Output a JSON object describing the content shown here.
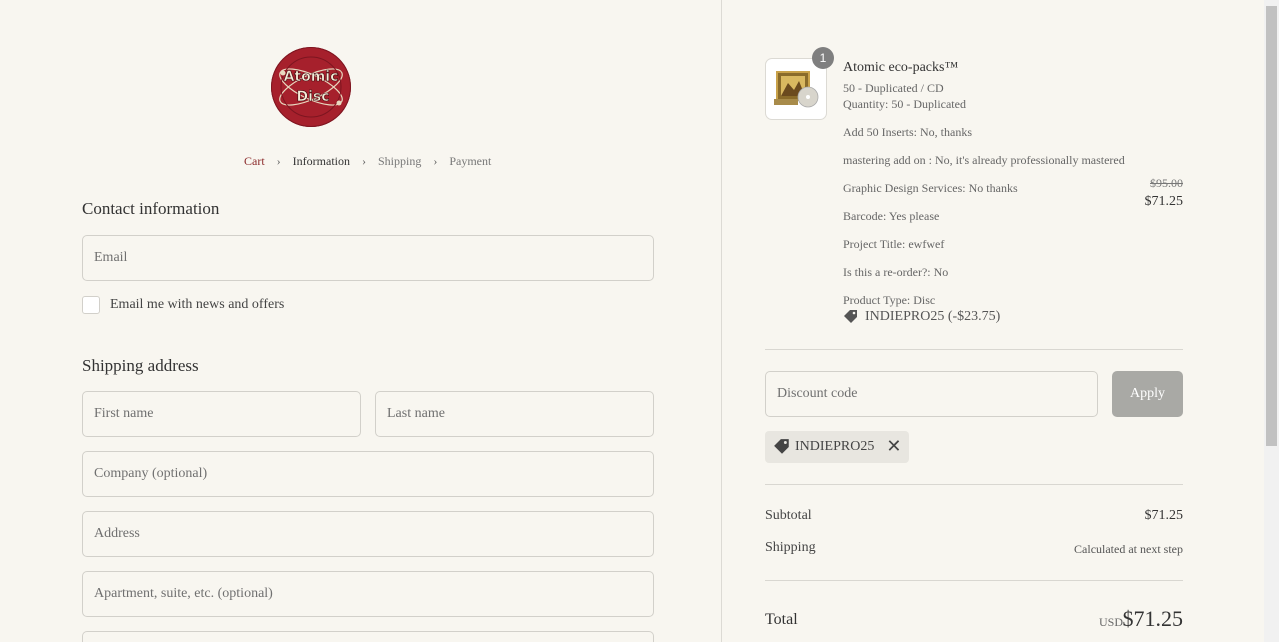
{
  "brand": {
    "logo_text_line1": "Atomic",
    "logo_text_line2": "Disc",
    "logo_color": "#a6202c"
  },
  "breadcrumb": {
    "items": [
      {
        "label": "Cart"
      },
      {
        "label": "Information"
      },
      {
        "label": "Shipping"
      },
      {
        "label": "Payment"
      }
    ]
  },
  "contact": {
    "title": "Contact information",
    "email_placeholder": "Email",
    "newsletter_label": "Email me with news and offers"
  },
  "shipping": {
    "title": "Shipping address",
    "first_name_placeholder": "First name",
    "last_name_placeholder": "Last name",
    "company_placeholder": "Company (optional)",
    "address_placeholder": "Address",
    "apartment_placeholder": "Apartment, suite, etc. (optional)"
  },
  "order": {
    "quantity_badge": "1",
    "product_name": "Atomic eco-packs™",
    "variant": "50 - Duplicated / CD",
    "quantity_line": "Quantity: 50 - Duplicated",
    "options": [
      "Add 50 Inserts: No, thanks",
      "mastering add on : No, it's already professionally mastered",
      "Graphic Design Services: No thanks",
      "Barcode: Yes please",
      "Project Title: ewfwef",
      "Is this a re-order?: No",
      "Product Type: Disc"
    ],
    "original_price": "$95.00",
    "price": "$71.25",
    "applied_discount": "INDIEPRO25 (-$23.75)"
  },
  "discount": {
    "placeholder": "Discount code",
    "apply_label": "Apply",
    "chip_code": "INDIEPRO25"
  },
  "summary": {
    "subtotal_label": "Subtotal",
    "subtotal_value": "$71.25",
    "shipping_label": "Shipping",
    "shipping_value": "Calculated at next step",
    "total_label": "Total",
    "currency": "USD",
    "total_value": "$71.25"
  }
}
